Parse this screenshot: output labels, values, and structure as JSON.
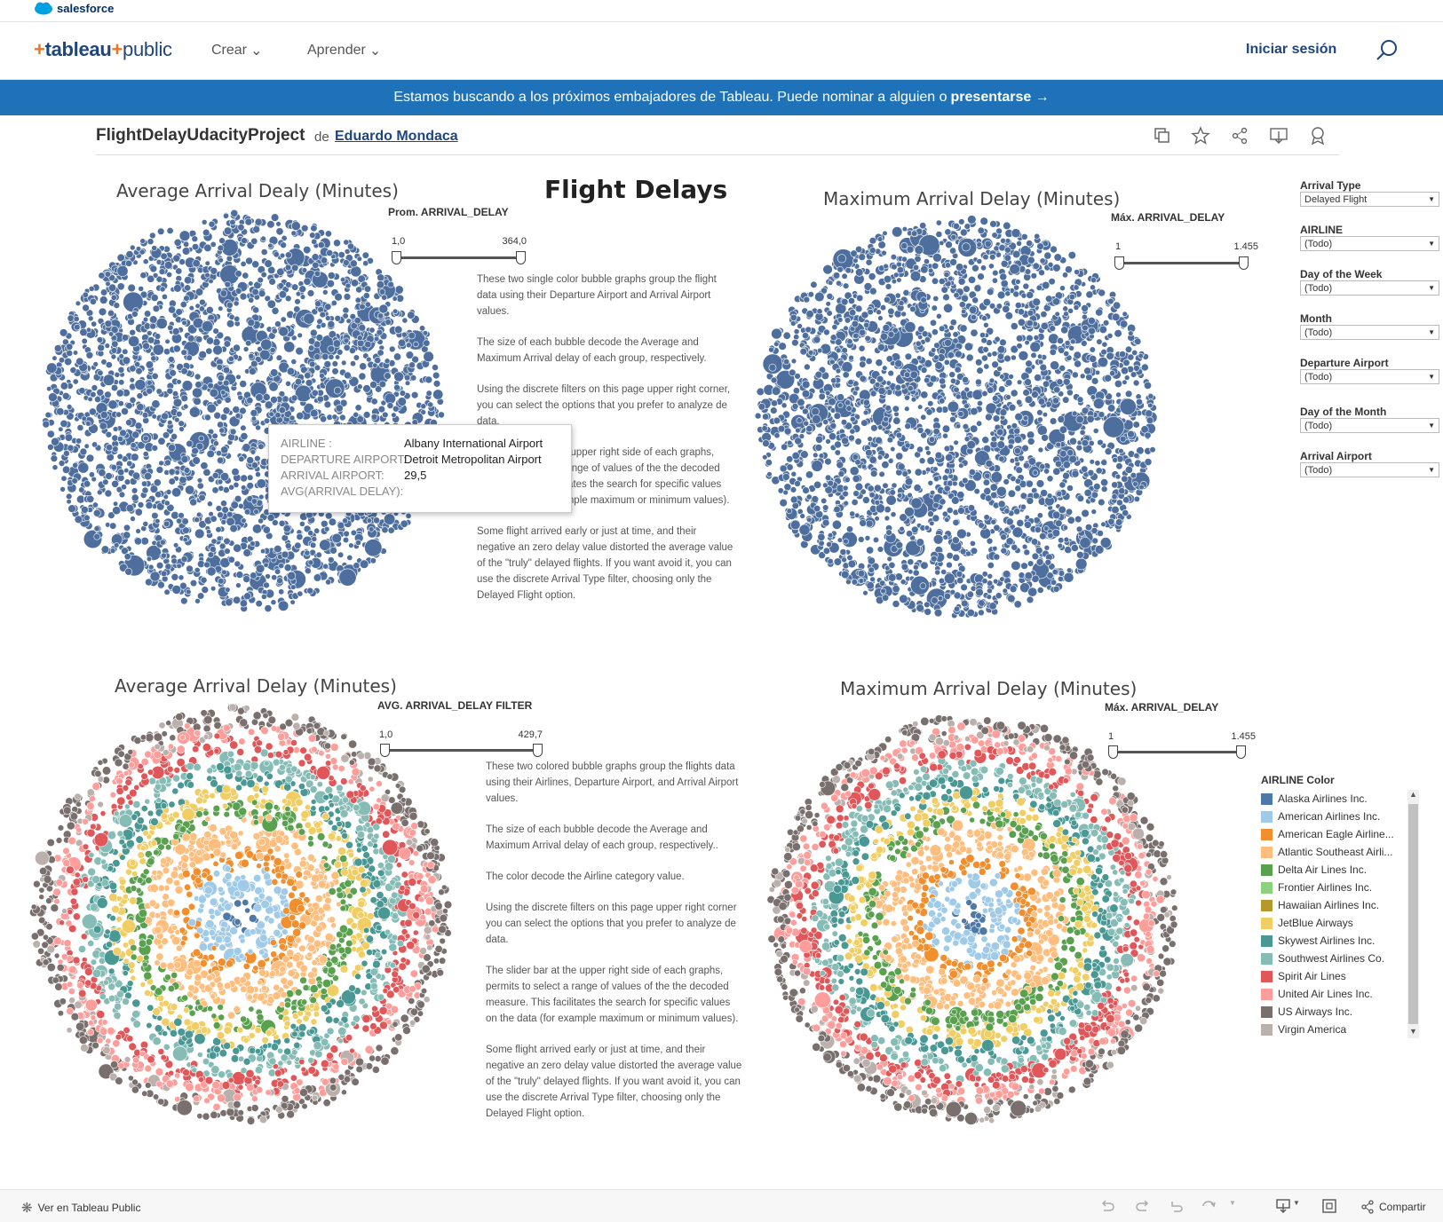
{
  "topbar": {
    "brand": "salesforce"
  },
  "nav": {
    "logo": "+tableau+public",
    "logo_main": "tableau",
    "logo_sub": "public",
    "links": [
      "Crear",
      "Aprender"
    ],
    "login": "Iniciar sesión",
    "search_icon": "search-icon"
  },
  "banner": {
    "text": "Estamos buscando a los próximos embajadores de Tableau. Puede nominar a alguien o",
    "link": "presentarse →"
  },
  "workbook": {
    "title": "FlightDelayUdacityProject",
    "by": "de",
    "author": "Eduardo Mondaca",
    "toolbar_icons": [
      "copy-icon",
      "star-icon",
      "share-icon",
      "download-icon",
      "badge-icon"
    ]
  },
  "dashboard": {
    "main_title": "Flight Delays",
    "chart1_title": "Average Arrival Dealy (Minutes)",
    "chart2_title": "Maximum Arrival Delay (Minutes)",
    "chart3_title": "Average Arrival Delay (Minutes)",
    "chart4_title": "Maximum Arrival Delay (Minutes)",
    "slider1": {
      "label": "Prom. ARRIVAL_DELAY",
      "min": "1,0",
      "max": "364,0"
    },
    "slider2": {
      "label": "Máx. ARRIVAL_DELAY",
      "min": "1",
      "max": "1.455"
    },
    "slider3": {
      "label": "AVG. ARRIVAL_DELAY FILTER",
      "min": "1,0",
      "max": "429,7"
    },
    "slider4": {
      "label": "Máx. ARRIVAL_DELAY",
      "min": "1",
      "max": "1.455"
    },
    "desc1": [
      "These two single color bubble graphs group the flight data using their Departure Airport and Arrival Airport values.",
      "The size of each bubble decode the Average and Maximum Arrival delay of each group, respectively.",
      "Using the discrete filters on this page upper right corner, you can select the options that you prefer to analyze de data.",
      "The slider bar at the upper right side of each graphs, permits to select a range of values of the the decoded measure. This facilitates the search for specific values on the data (for example maximum or minimum values).",
      "Some flight arrived early or just at time, and their negative an zero delay value distorted the average value of the \"truly\" delayed flights. If you want avoid it, you can use the discrete Arrival Type filter, choosing only the Delayed Flight option."
    ],
    "desc2": [
      "These two colored bubble graphs group the flights data using their Airlines,  Departure Airport, and Arrival Airport values.",
      "The size of each bubble decode the Average and Maximum Arrival delay of each group, respectively..",
      "The color decode the Airline category value.",
      "Using the discrete filters on this page upper right corner you can select the options that you prefer to analyze de data.",
      "The slider bar at the upper right side of each graphs, permits to select a range of values of the the decoded measure. This facilitates the search for specific values on the data (for example maximum or minimum values).",
      "Some flight arrived early or just at time, and their negative an zero delay value distorted the average value of the \"truly\" delayed flights. If you want avoid it, you can use the discrete Arrival Type filter, choosing only the Delayed Flight option."
    ],
    "filters": [
      {
        "label": "Arrival Type",
        "value": "Delayed Flight"
      },
      {
        "label": "AIRLINE",
        "value": "(Todo)"
      },
      {
        "label": "Day of the Week",
        "value": "(Todo)"
      },
      {
        "label": "Month",
        "value": "(Todo)"
      },
      {
        "label": "Departure Airport",
        "value": "(Todo)"
      },
      {
        "label": "Day of the Month",
        "value": "(Todo)"
      },
      {
        "label": "Arrival Airport",
        "value": "(Todo)"
      }
    ],
    "tooltip": {
      "rows": [
        {
          "key": "AIRLINE :",
          "value": ""
        },
        {
          "key": "DEPARTURE AIRPORT:",
          "value": "Albany International Airport"
        },
        {
          "key": "ARRIVAL AIRPORT:",
          "value": "Detroit Metropolitan Airport"
        },
        {
          "key": "AVG(ARRIVAL DELAY):",
          "value": "29,5"
        }
      ]
    },
    "legend": {
      "title": "AIRLINE Color",
      "items": [
        {
          "name": "Alaska Airlines Inc.",
          "color": "#4e79a7"
        },
        {
          "name": "American Airlines Inc.",
          "color": "#a0cbe8"
        },
        {
          "name": "American Eagle Airline...",
          "color": "#f28e2b"
        },
        {
          "name": "Atlantic Southeast Airli...",
          "color": "#ffbe7d"
        },
        {
          "name": "Delta Air Lines Inc.",
          "color": "#59a14f"
        },
        {
          "name": "Frontier Airlines Inc.",
          "color": "#8cd17d"
        },
        {
          "name": "Hawaiian Airlines Inc.",
          "color": "#b6992d"
        },
        {
          "name": "JetBlue Airways",
          "color": "#f1ce63"
        },
        {
          "name": "Skywest Airlines Inc.",
          "color": "#499894"
        },
        {
          "name": "Southwest Airlines Co.",
          "color": "#86bcb6"
        },
        {
          "name": "Spirit Air Lines",
          "color": "#e15759"
        },
        {
          "name": "United Air Lines Inc.",
          "color": "#ff9d9a"
        },
        {
          "name": "US Airways Inc.",
          "color": "#79706e"
        },
        {
          "name": "Virgin America",
          "color": "#bab0ac"
        }
      ]
    },
    "single_color": "#4e6f9e"
  },
  "bottombar": {
    "view_label": "Ver en Tableau Public",
    "share_label": "Compartir",
    "icons": [
      "undo-icon",
      "redo-icon",
      "revert-icon",
      "refresh-icon",
      "download-icon",
      "fullscreen-icon",
      "share-icon"
    ]
  }
}
